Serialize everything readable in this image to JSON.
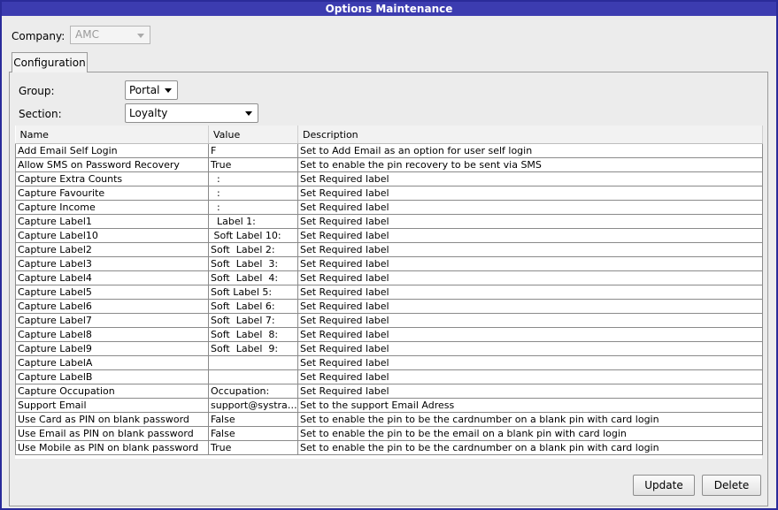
{
  "window": {
    "title": "Options Maintenance"
  },
  "company": {
    "label": "Company:",
    "value": "AMC"
  },
  "tabs": [
    {
      "label": "Configuration"
    }
  ],
  "group": {
    "label": "Group:",
    "value": "Portal"
  },
  "section": {
    "label": "Section:",
    "value": "Loyalty"
  },
  "table": {
    "columns": [
      "Name",
      "Value",
      "Description"
    ],
    "rows": [
      [
        "Add Email Self Login",
        "F",
        "Set to Add Email as an option for user self login"
      ],
      [
        "Allow SMS on Password Recovery",
        "True",
        "Set to enable the pin recovery to be sent via SMS"
      ],
      [
        "Capture Extra Counts",
        "  :",
        "Set Required label"
      ],
      [
        "Capture Favourite",
        "  :",
        "Set Required label"
      ],
      [
        "Capture Income",
        "  :",
        "Set Required label"
      ],
      [
        "Capture Label1",
        "  Label 1:",
        "Set Required label"
      ],
      [
        "Capture Label10",
        " Soft Label 10:",
        "Set Required label"
      ],
      [
        "Capture Label2",
        "Soft  Label 2:",
        "Set Required label"
      ],
      [
        "Capture Label3",
        "Soft  Label  3:",
        "Set Required label"
      ],
      [
        "Capture Label4",
        "Soft  Label  4:",
        "Set Required label"
      ],
      [
        "Capture Label5",
        "Soft Label 5:",
        "Set Required label"
      ],
      [
        "Capture Label6",
        "Soft  Label 6:",
        "Set Required label"
      ],
      [
        "Capture Label7",
        "Soft  Label 7:",
        "Set Required label"
      ],
      [
        "Capture Label8",
        "Soft  Label  8:",
        "Set Required label"
      ],
      [
        "Capture Label9",
        "Soft  Label  9:",
        "Set Required label"
      ],
      [
        "Capture LabelA",
        "",
        "Set Required label"
      ],
      [
        "Capture LabelB",
        "",
        "Set Required label"
      ],
      [
        "Capture Occupation",
        "Occupation:",
        "Set Required label"
      ],
      [
        "Support Email",
        "support@systraq...",
        "Set to the support Email Adress"
      ],
      [
        "Use Card as PIN on blank password",
        "False",
        "Set to enable the pin to be the cardnumber on a blank pin with card login"
      ],
      [
        "Use Email as PIN on blank password",
        "False",
        "Set to enable the pin to be the email on a blank pin with card login"
      ],
      [
        "Use Mobile as PIN on blank password",
        "True",
        "Set to enable the pin to be the cardnumber on a blank pin with card login"
      ]
    ]
  },
  "buttons": {
    "update": "Update",
    "delete": "Delete"
  }
}
